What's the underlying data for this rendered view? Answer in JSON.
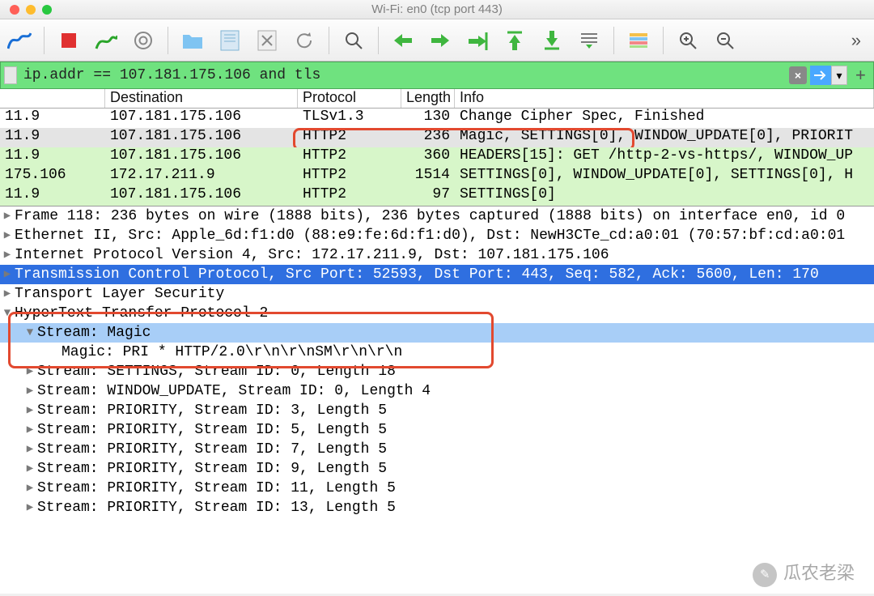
{
  "window": {
    "title": "Wi-Fi: en0 (tcp port 443)"
  },
  "filter": {
    "value": "ip.addr == 107.181.175.106 and tls",
    "clear_hint": "×",
    "arrow_hint": "→",
    "dd_hint": "▾",
    "plus": "+"
  },
  "more_icon": "»",
  "packet_columns": {
    "src": "",
    "dst": "Destination",
    "proto": "Protocol",
    "length": "Length",
    "info": "Info"
  },
  "packets": [
    {
      "bg": "pr-white",
      "src": "11.9",
      "dst": "107.181.175.106",
      "proto": "TLSv1.3",
      "len": "130",
      "info": "Change Cipher Spec, Finished"
    },
    {
      "bg": "pr-grey",
      "src": "11.9",
      "dst": "107.181.175.106",
      "proto": "HTTP2",
      "len": "236",
      "info": "Magic, SETTINGS[0], WINDOW_UPDATE[0], PRIORIT",
      "boxed": true
    },
    {
      "bg": "pr-green",
      "src": "11.9",
      "dst": "107.181.175.106",
      "proto": "HTTP2",
      "len": "360",
      "info": "HEADERS[15]: GET /http-2-vs-https/, WINDOW_UP"
    },
    {
      "bg": "pr-green",
      "src": "175.106",
      "dst": "172.17.211.9",
      "proto": "HTTP2",
      "len": "1514",
      "info": "SETTINGS[0], WINDOW_UPDATE[0], SETTINGS[0], H"
    },
    {
      "bg": "pr-green",
      "src": "11.9",
      "dst": "107.181.175.106",
      "proto": "HTTP2",
      "len": "97",
      "info": "SETTINGS[0]"
    }
  ],
  "details": {
    "lines": [
      {
        "type": "closed",
        "text": "Frame 118: 236 bytes on wire (1888 bits), 236 bytes captured (1888 bits) on interface en0, id 0"
      },
      {
        "type": "closed",
        "text": "Ethernet II, Src: Apple_6d:f1:d0 (88:e9:fe:6d:f1:d0), Dst: NewH3CTe_cd:a0:01 (70:57:bf:cd:a0:01"
      },
      {
        "type": "closed",
        "text": "Internet Protocol Version 4, Src: 172.17.211.9, Dst: 107.181.175.106"
      },
      {
        "type": "closed",
        "sel": true,
        "text": "Transmission Control Protocol, Src Port: 52593, Dst Port: 443, Seq: 582, Ack: 5600, Len: 170"
      },
      {
        "type": "closed",
        "text": "Transport Layer Security"
      },
      {
        "type": "open",
        "text": "HyperText Transfer Protocol 2"
      }
    ],
    "magic_header": "Stream: Magic",
    "magic_value": "Magic: PRI * HTTP/2.0\\r\\n\\r\\nSM\\r\\n\\r\\n",
    "streams": [
      "Stream: SETTINGS, Stream ID: 0, Length 18",
      "Stream: WINDOW_UPDATE, Stream ID: 0, Length 4",
      "Stream: PRIORITY, Stream ID: 3, Length 5",
      "Stream: PRIORITY, Stream ID: 5, Length 5",
      "Stream: PRIORITY, Stream ID: 7, Length 5",
      "Stream: PRIORITY, Stream ID: 9, Length 5",
      "Stream: PRIORITY, Stream ID: 11, Length 5",
      "Stream: PRIORITY, Stream ID: 13, Length 5"
    ]
  },
  "watermark": {
    "text": "瓜农老梁"
  }
}
